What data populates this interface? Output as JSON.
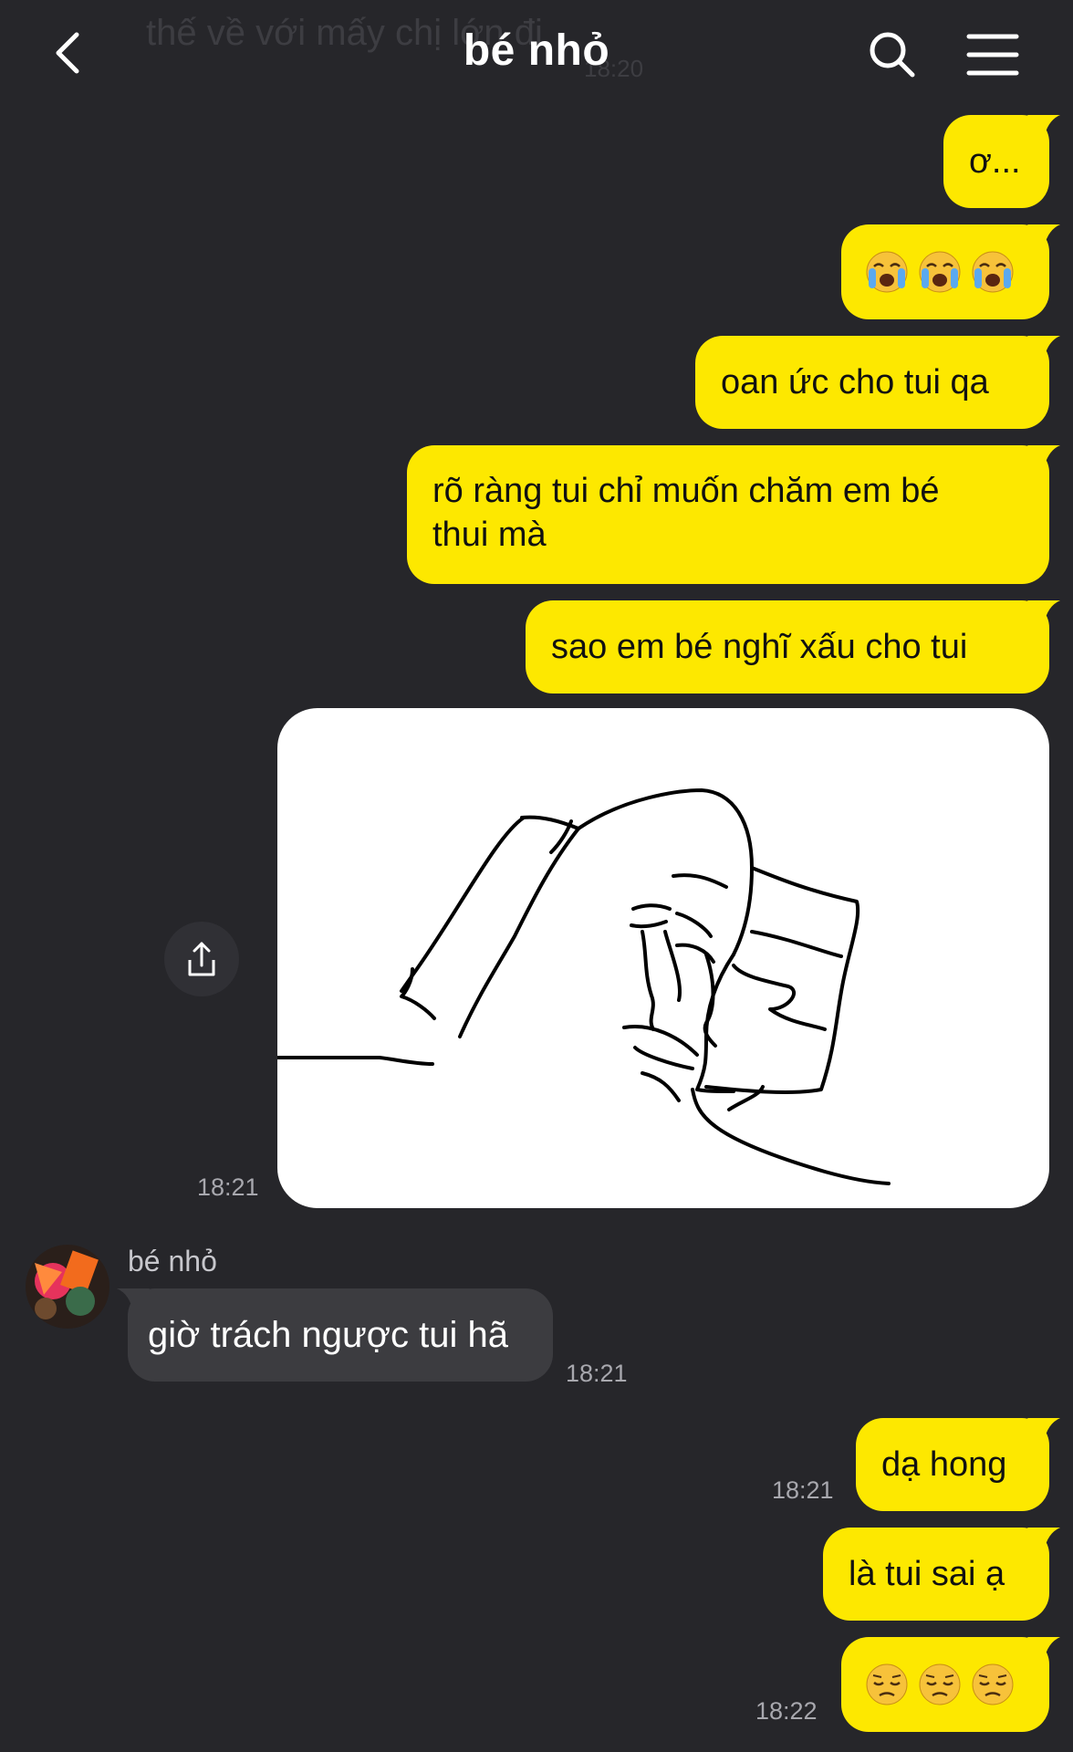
{
  "header": {
    "title": "bé nhỏ",
    "ghost_text": "thế về với mấy chị lớn đi",
    "ghost_time": "18:20"
  },
  "messages": {
    "m1": "ơ...",
    "m3": "oan ức cho tui qa",
    "m4_line1": "rõ ràng tui chỉ muốn chăm em bé",
    "m4_line2": "thui mà",
    "m5": "sao em bé nghĩ xấu cho tui",
    "image_time": "18:21",
    "incoming_name": "bé nhỏ",
    "incoming_text": "giờ trách ngược tui hã",
    "incoming_time": "18:21",
    "m7": "dạ hong",
    "m7_time": "18:21",
    "m8": "là tui sai ạ",
    "m9_time": "18:22"
  },
  "emojis": {
    "crying": "loudly-crying-face",
    "pensive": "pensive-face"
  },
  "colors": {
    "background": "#26262a",
    "outgoing_bubble": "#fde800",
    "incoming_bubble": "#3c3c40",
    "timestamp": "#a8a8ae"
  },
  "icons": {
    "back": "chevron-left-icon",
    "search": "search-icon",
    "menu": "hamburger-menu-icon",
    "share": "share-icon"
  }
}
